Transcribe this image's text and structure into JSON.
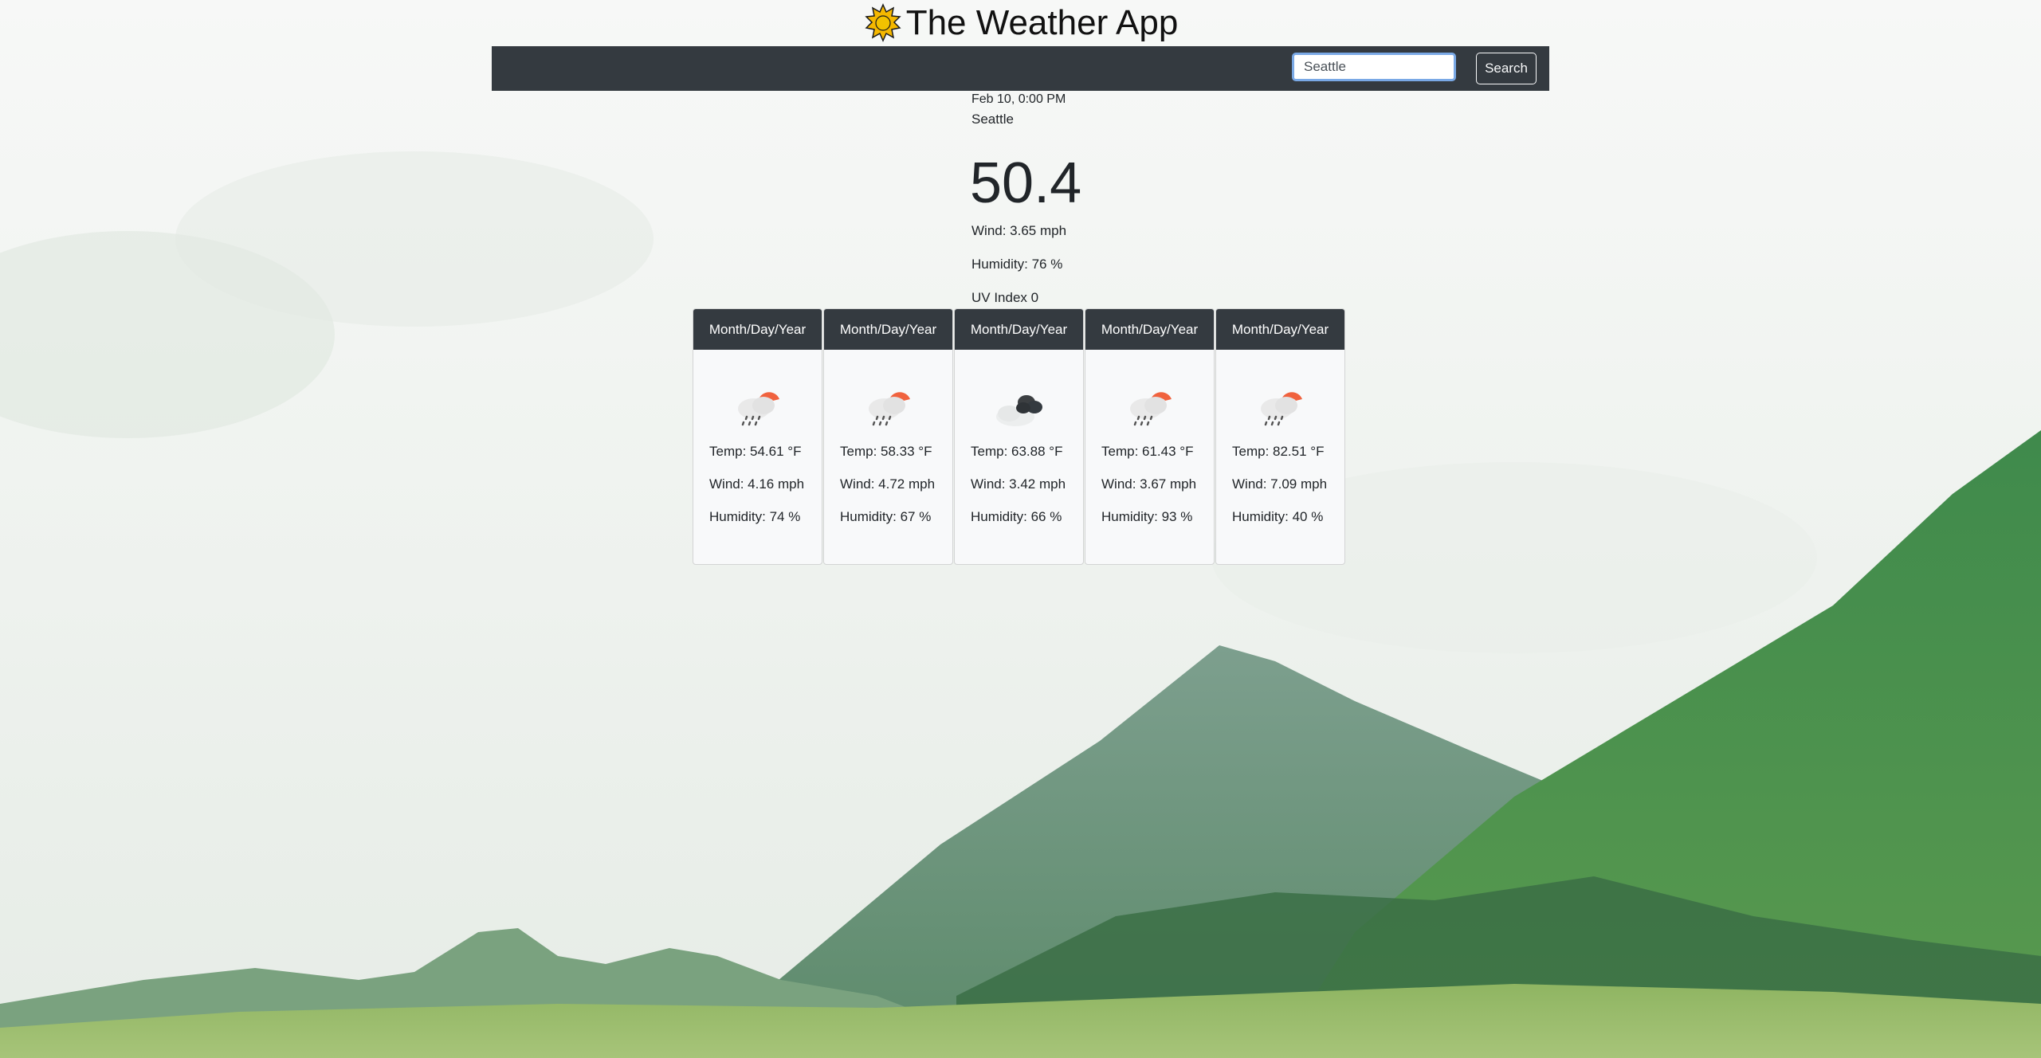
{
  "app": {
    "title": "The Weather App",
    "title_icon": "sun-icon"
  },
  "search": {
    "value": "Seattle",
    "placeholder": "",
    "button_label": "Search"
  },
  "current": {
    "date": "Feb 10, 0:00 PM",
    "city": "Seattle",
    "temp": "50.4",
    "wind": "Wind: 3.65 mph",
    "humidity": "Humidity: 76 %",
    "uv": "UV Index 0"
  },
  "forecast": [
    {
      "header": "Month/Day/Year",
      "icon": "rain-cloud-sun-icon",
      "temp": "Temp: 54.61 °F",
      "wind": "Wind: 4.16 mph",
      "humidity": "Humidity: 74 %"
    },
    {
      "header": "Month/Day/Year",
      "icon": "rain-cloud-sun-icon",
      "temp": "Temp: 58.33 °F",
      "wind": "Wind: 4.72 mph",
      "humidity": "Humidity: 67 %"
    },
    {
      "header": "Month/Day/Year",
      "icon": "dark-clouds-icon",
      "temp": "Temp: 63.88 °F",
      "wind": "Wind: 3.42 mph",
      "humidity": "Humidity: 66 %"
    },
    {
      "header": "Month/Day/Year",
      "icon": "rain-cloud-sun-icon",
      "temp": "Temp: 61.43 °F",
      "wind": "Wind: 3.67 mph",
      "humidity": "Humidity: 93 %"
    },
    {
      "header": "Month/Day/Year",
      "icon": "rain-cloud-sun-icon",
      "temp": "Temp: 82.51 °F",
      "wind": "Wind: 7.09 mph",
      "humidity": "Humidity: 40 %"
    }
  ],
  "colors": {
    "navbar": "#343a40",
    "card_bg": "#f8f9fa",
    "sun_accent": "#f0623e",
    "hill_green": "#5f9a5a"
  }
}
